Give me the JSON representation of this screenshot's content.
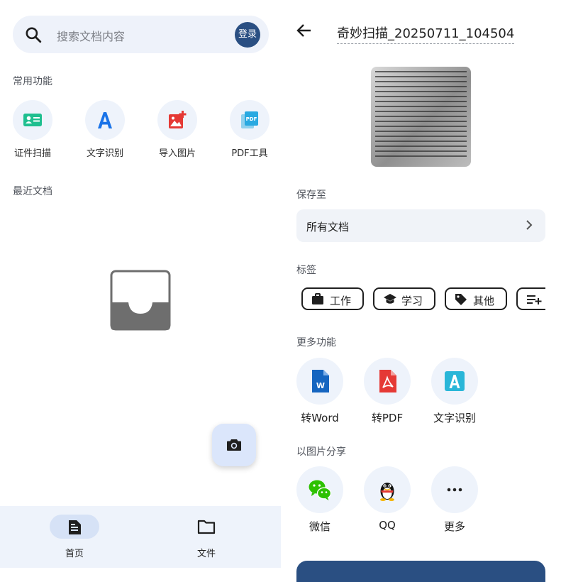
{
  "left": {
    "search": {
      "placeholder": "搜索文档内容",
      "login_label": "登录"
    },
    "quick_section_title": "常用功能",
    "quick_items": [
      {
        "label": "证件扫描",
        "icon": "id-card-icon",
        "color": "#1fbf8f"
      },
      {
        "label": "文字识别",
        "icon": "letter-a-icon",
        "color": "#1a73e8"
      },
      {
        "label": "导入图片",
        "icon": "add-image-icon",
        "color": "#e53935"
      },
      {
        "label": "PDF工具",
        "icon": "pdf-tool-icon",
        "color": "#29a9e1"
      }
    ],
    "recent_section_title": "最近文档",
    "bottom_nav": [
      {
        "label": "首页",
        "icon": "document-icon",
        "active": true
      },
      {
        "label": "文件",
        "icon": "folder-icon",
        "active": false
      }
    ]
  },
  "right": {
    "title": "奇妙扫描_20250711_104504",
    "save_to_label": "保存至",
    "save_to_value": "所有文档",
    "tags_label": "标签",
    "tags": [
      {
        "label": "工作",
        "icon": "briefcase-icon"
      },
      {
        "label": "学习",
        "icon": "graduation-cap-icon"
      },
      {
        "label": "其他",
        "icon": "tag-icon"
      }
    ],
    "more_label": "更多功能",
    "more_items": [
      {
        "label": "转Word",
        "icon": "word-icon",
        "color": "#1565c0"
      },
      {
        "label": "转PDF",
        "icon": "pdf-icon",
        "color": "#e53935"
      },
      {
        "label": "文字识别",
        "icon": "ocr-icon",
        "color": "#29b6d8"
      }
    ],
    "share_label": "以图片分享",
    "share_items": [
      {
        "label": "微信",
        "icon": "wechat-icon",
        "color": "#2dc100"
      },
      {
        "label": "QQ",
        "icon": "qq-icon",
        "color": "#111111"
      },
      {
        "label": "更多",
        "icon": "more-dots-icon",
        "color": "#222222"
      }
    ]
  }
}
